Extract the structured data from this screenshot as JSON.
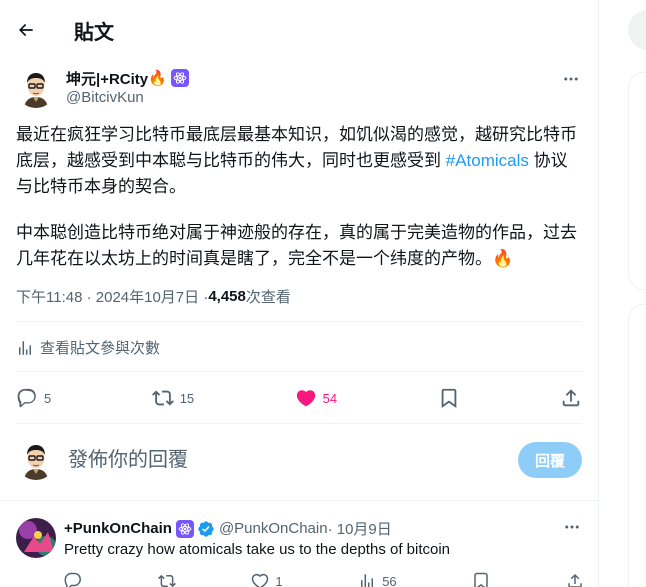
{
  "header": {
    "title": "貼文"
  },
  "tweet": {
    "author": {
      "name": "坤元|+RCity",
      "handle": "@BitcivKun",
      "emoji": "🔥"
    },
    "text_p1_before": "最近在疯狂学习比特币最底层最基本知识，如饥似渴的感觉，越研究比特币底层，越感受到中本聪与比特币的伟大，同时也更感受到 ",
    "hashtag": "#Atomicals",
    "text_p1_after": " 协议与比特币本身的契合。",
    "text_p2": "中本聪创造比特币绝对属于神迹般的存在，真的属于完美造物的作品，过去几年花在以太坊上的时间真是瞎了，完全不是一个纬度的产物。",
    "text_p2_emoji": "🔥",
    "time": "下午11:48 · 2024年10月7日 · ",
    "views_count": "4,458",
    "views_label": " 次查看",
    "analytics_label": "查看貼文參與次數",
    "replies": "5",
    "reposts": "15",
    "likes": "54"
  },
  "composer": {
    "placeholder": "發佈你的回覆",
    "button": "回覆"
  },
  "reply": {
    "name": "+PunkOnChain",
    "handle": "@PunkOnChain",
    "date": " · 10月9日",
    "text": "Pretty crazy how atomicals take us to the depths of bitcoin",
    "replies": "",
    "reposts": "",
    "likes": "1",
    "views": "56"
  },
  "colors": {
    "accent": "#1d9bf0",
    "like": "#f91880",
    "muted": "#536471",
    "badge": "#7856ff"
  }
}
